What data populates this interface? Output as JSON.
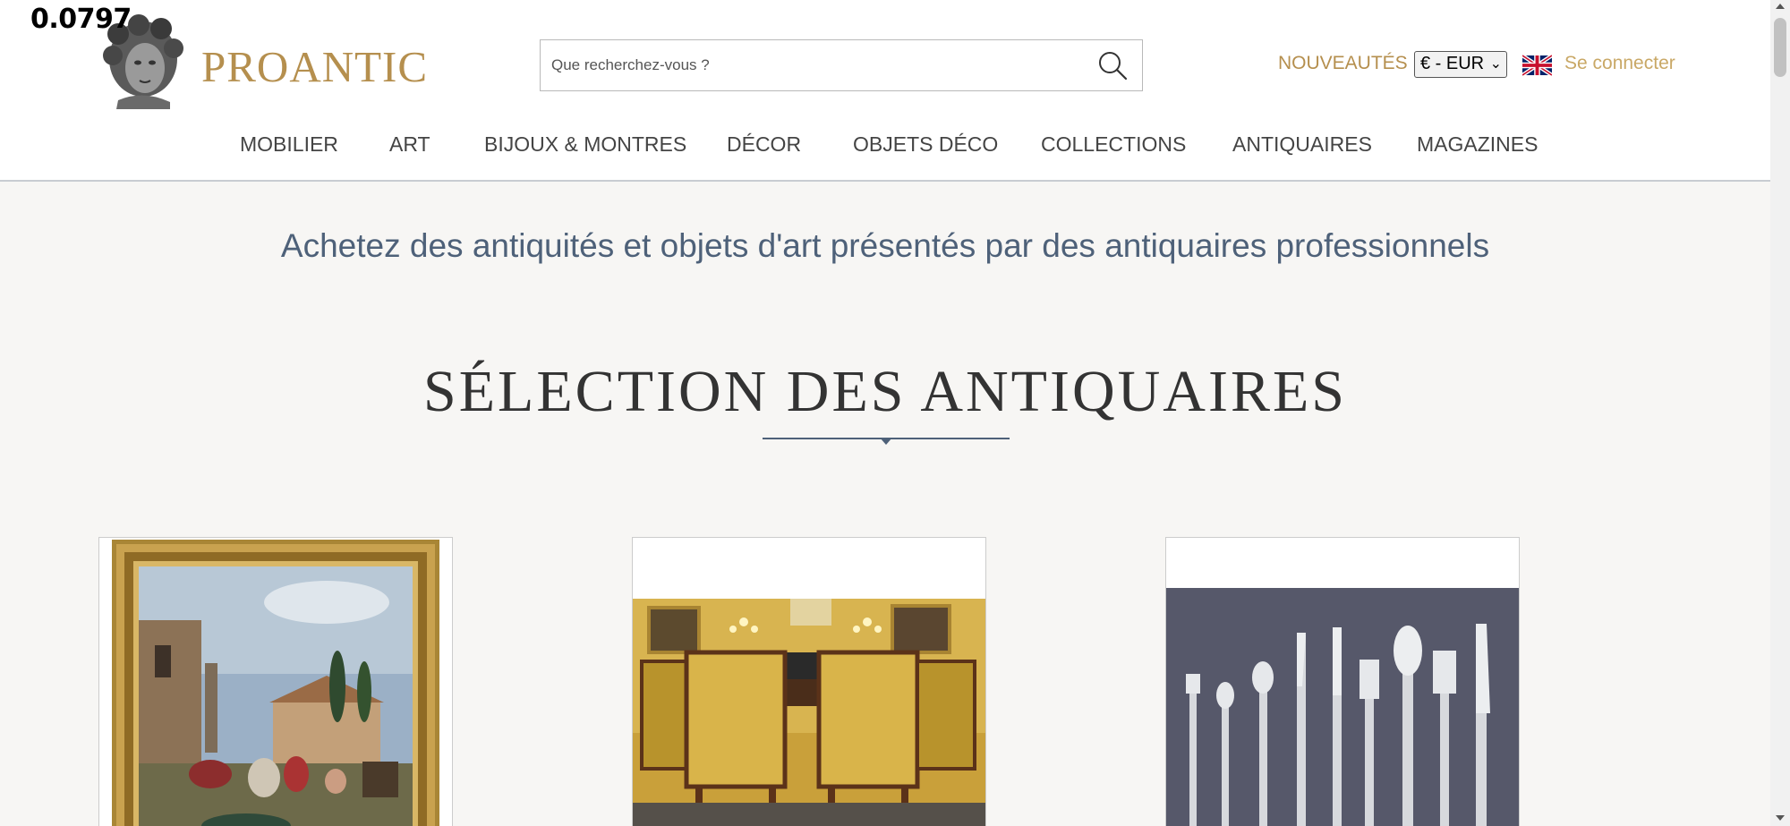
{
  "overlay": {
    "value": "0.0797"
  },
  "header": {
    "logo_text": "PROANTIC",
    "search_placeholder": "Que recherchez-vous ?",
    "nouveautes": "NOUVEAUTÉS",
    "currency": "€ - EUR",
    "login": "Se connecter"
  },
  "nav": {
    "items": [
      {
        "label": "MOBILIER"
      },
      {
        "label": "ART"
      },
      {
        "label": "BIJOUX & MONTRES"
      },
      {
        "label": "DÉCOR"
      },
      {
        "label": "OBJETS DÉCO"
      },
      {
        "label": "COLLECTIONS"
      },
      {
        "label": "ANTIQUAIRES"
      },
      {
        "label": "MAGAZINES"
      }
    ]
  },
  "main": {
    "tagline": "Achetez des antiquités et objets d'art présentés par des antiquaires professionnels",
    "section_title": "SÉLECTION DES ANTIQUAIRES"
  },
  "colors": {
    "brand_gold": "#b58f4e",
    "accent_blue": "#4e6179",
    "background": "#f7f6f4"
  },
  "icons": {
    "search": "search-icon",
    "flag": "uk-flag-icon",
    "logo": "logo-bust-icon"
  }
}
